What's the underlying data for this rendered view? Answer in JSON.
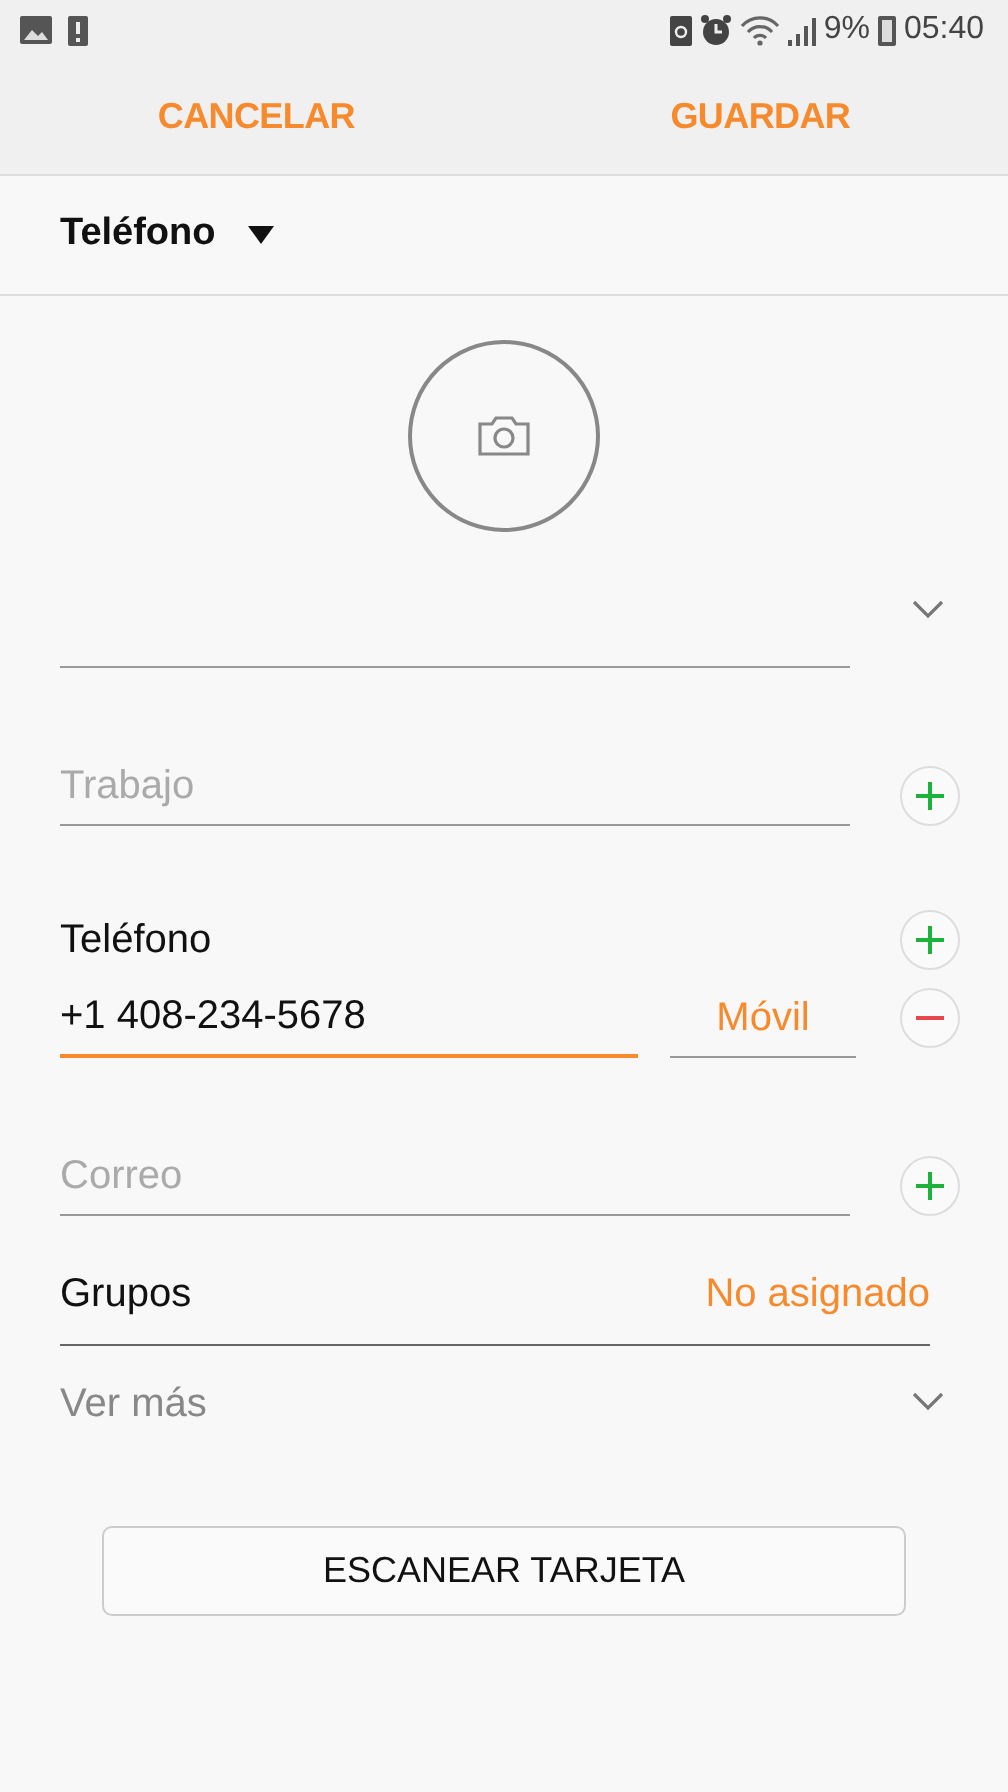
{
  "status_bar": {
    "battery": "9%",
    "time": "05:40"
  },
  "toolbar": {
    "cancel": "CANCELAR",
    "save": "GUARDAR"
  },
  "account": {
    "label": "Teléfono"
  },
  "fields": [
    {
      "kind": "name"
    },
    {
      "kind": "text",
      "placeholder": "Trabajo"
    },
    {
      "kind": "phone",
      "label": "Teléfono",
      "value": "+1 408-234-5678",
      "type": "Móvil",
      "focused": true
    },
    {
      "kind": "text",
      "placeholder": "Correo"
    },
    {
      "kind": "groups",
      "label": "Grupos",
      "value": "No asignado"
    },
    {
      "kind": "more",
      "label": "Ver más"
    }
  ],
  "scan_button": "ESCANEAR TARJETA"
}
